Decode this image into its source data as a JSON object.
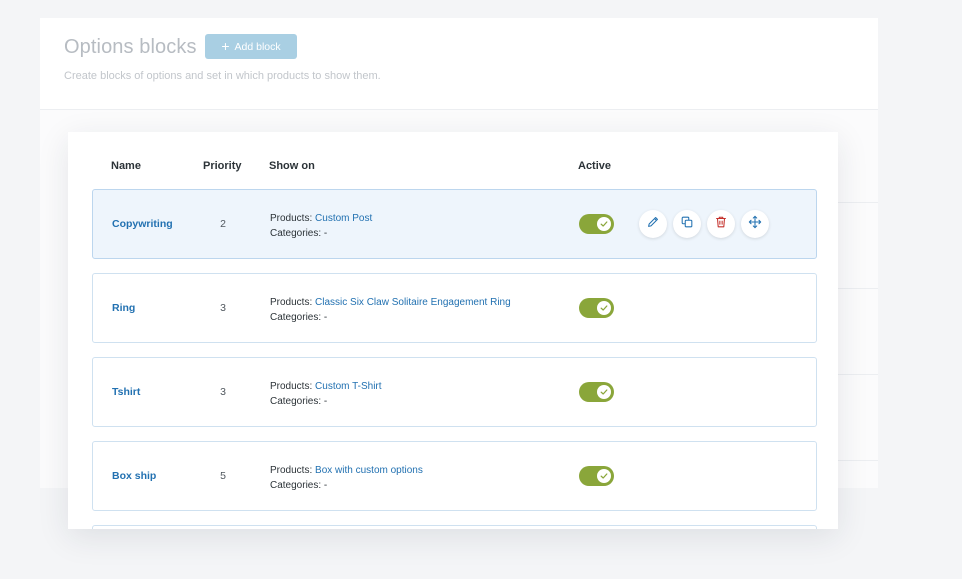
{
  "header": {
    "title": "Options blocks",
    "add_button_label": "Add block",
    "subtitle": "Create blocks of options and set in which products to show them."
  },
  "table": {
    "columns": {
      "name": "Name",
      "priority": "Priority",
      "show_on": "Show on",
      "active": "Active"
    },
    "products_label": "Products:",
    "categories_label": "Categories:",
    "rows": [
      {
        "name": "Copywriting",
        "priority": "2",
        "product": "Custom Post",
        "categories": "-",
        "active": true,
        "selected": true
      },
      {
        "name": "Ring",
        "priority": "3",
        "product": "Classic Six Claw Solitaire Engagement Ring",
        "categories": "-",
        "active": true
      },
      {
        "name": "Tshirt",
        "priority": "3",
        "product": "Custom T-Shirt",
        "categories": "-",
        "active": true
      },
      {
        "name": "Box ship",
        "priority": "5",
        "product": "Box with custom options",
        "categories": "-",
        "active": true
      }
    ]
  },
  "row_actions": [
    "pencil-icon",
    "duplicate-icon",
    "trash-icon",
    "move-icon"
  ],
  "colors": {
    "accent": "#2271b1",
    "toggle_on": "#8aa63a",
    "delete": "#c4302b",
    "selected_row": "#eef5fc"
  }
}
